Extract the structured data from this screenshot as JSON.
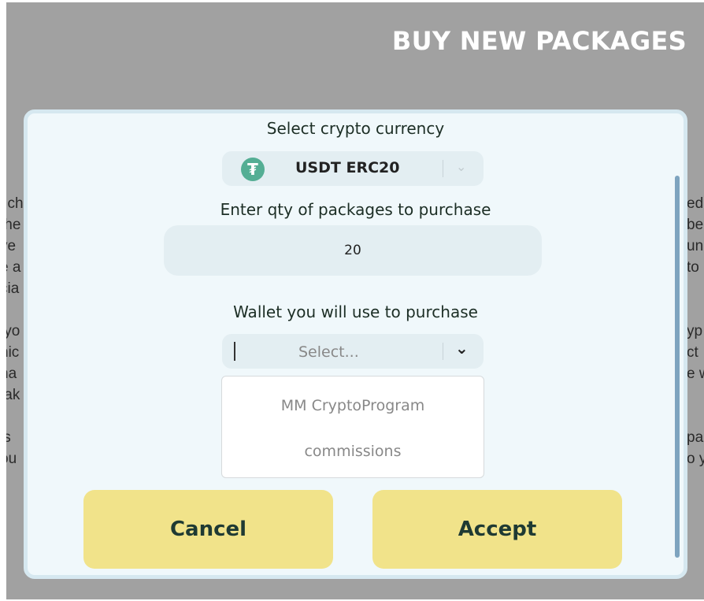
{
  "page": {
    "title": "BUY NEW PACKAGES"
  },
  "background_text": {
    "left": "l ch\nthe\nve\ne a\ncia\n\n yo\nhic\nha\ntak\n\nls\nou",
    "right": "ed\nbe\nun\nto\n\n\nyp\nct\ne w\n\n\npa\no y"
  },
  "modal": {
    "currency": {
      "label": "Select crypto currency",
      "selected": "USDT ERC20",
      "icon": "tether-icon",
      "icon_glyph": "₮"
    },
    "quantity": {
      "label": "Enter qty of packages to purchase",
      "value": "20"
    },
    "wallet": {
      "label": "Wallet you will use to purchase",
      "placeholder": "Select...",
      "options": [
        "MM CryptoProgram",
        "commissions"
      ]
    },
    "buttons": {
      "cancel": "Cancel",
      "accept": "Accept"
    }
  },
  "colors": {
    "backdrop": "#a1a1a1",
    "modal": "#f0f8fb",
    "button": "#f1e38a",
    "tether": "#54ae94"
  }
}
